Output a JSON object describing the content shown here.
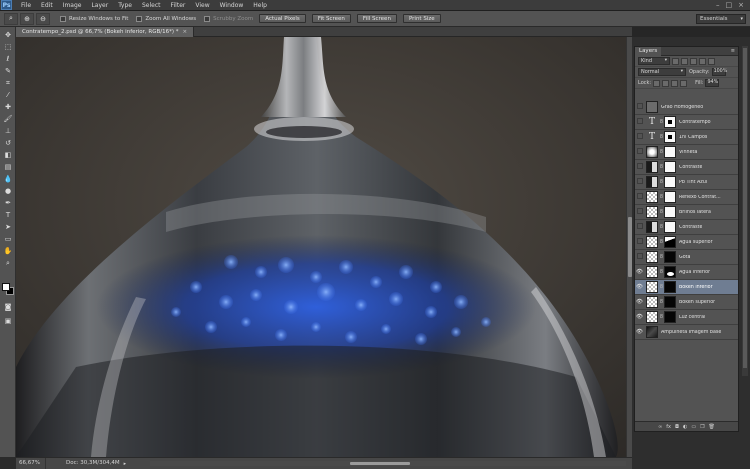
{
  "app": {
    "logo": "Ps"
  },
  "menu": [
    "File",
    "Edit",
    "Image",
    "Layer",
    "Type",
    "Select",
    "Filter",
    "View",
    "Window",
    "Help"
  ],
  "window_controls": [
    "–",
    "□",
    "×"
  ],
  "options": {
    "tool_icons": [
      "zoom-tool-icon",
      "zoom-in-icon",
      "zoom-out-icon"
    ],
    "resize_windows": "Resize Windows to Fit",
    "zoom_all": "Zoom All Windows",
    "scrubby_zoom": "Scrubby Zoom",
    "actual_pixels": "Actual Pixels",
    "fit_screen": "Fit Screen",
    "fill_screen": "Fill Screen",
    "print_size": "Print Size",
    "workspace": "Essentials"
  },
  "document": {
    "tab_title": "Contratempo_2.psd @ 66,7% (Bokeh inferior, RGB/16*) *",
    "zoom": "66,67%",
    "doc_size": "Doc: 30,3M/304,4M"
  },
  "layers_panel": {
    "title": "Layers",
    "filter_kind": "Kind",
    "blend_mode": "Normal",
    "opacity_label": "Opacity:",
    "opacity_value": "100%",
    "lock_label": "Lock:",
    "fill_label": "Fill:",
    "fill_value": "94%",
    "layers": [
      {
        "name": "Grao Homogeneo",
        "thumb": "gray",
        "mask": "",
        "visible": false,
        "selected": false
      },
      {
        "name": "Contratempo",
        "thumb": "text",
        "mask": "whitedot",
        "visible": false,
        "selected": false
      },
      {
        "name": "1ni Campos",
        "thumb": "text",
        "mask": "whitedot",
        "visible": false,
        "selected": false
      },
      {
        "name": "Vinheta",
        "thumb": "vinh",
        "mask": "white",
        "visible": false,
        "selected": false
      },
      {
        "name": "Contraste",
        "thumb": "adj",
        "mask": "white",
        "visible": false,
        "selected": false
      },
      {
        "name": "Pb Tint Azul",
        "thumb": "adj",
        "mask": "white",
        "visible": false,
        "selected": false
      },
      {
        "name": "Reflexo Contrat...",
        "thumb": "checker",
        "mask": "white",
        "visible": false,
        "selected": false
      },
      {
        "name": "Brilhos latera",
        "thumb": "checker",
        "mask": "white",
        "visible": false,
        "selected": false
      },
      {
        "name": "Contraste",
        "thumb": "adj",
        "mask": "white",
        "visible": false,
        "selected": false
      },
      {
        "name": "Agua superior",
        "thumb": "checker",
        "mask": "wedge",
        "visible": false,
        "selected": false
      },
      {
        "name": "Gota",
        "thumb": "checker",
        "mask": "black",
        "visible": false,
        "selected": false
      },
      {
        "name": "Agua inferior",
        "thumb": "checker",
        "mask": "blackblob",
        "visible": true,
        "selected": false
      },
      {
        "name": "Bokeh inferior",
        "thumb": "checker",
        "mask": "black",
        "visible": true,
        "selected": true
      },
      {
        "name": "Bokeh superior",
        "thumb": "checker",
        "mask": "black",
        "visible": true,
        "selected": false
      },
      {
        "name": "Luz central",
        "thumb": "checker",
        "mask": "black",
        "visible": true,
        "selected": false
      },
      {
        "name": "Ampulheta Imagem base",
        "thumb": "photo",
        "mask": "",
        "visible": true,
        "selected": false
      }
    ],
    "footer_icons": [
      "link-icon",
      "fx-icon",
      "mask-icon",
      "adjustment-icon",
      "folder-icon",
      "new-layer-icon",
      "trash-icon"
    ]
  },
  "colors": {
    "accent": "#2e5a8a",
    "selected_layer": "#6f7d92",
    "bokeh_blue": "#2a5bd7"
  }
}
